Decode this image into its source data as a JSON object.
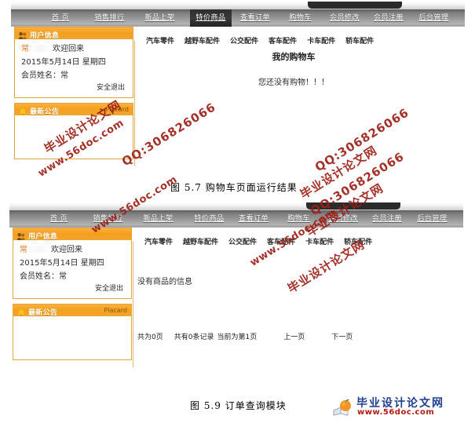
{
  "nav": {
    "items": [
      {
        "label": "首  页",
        "name": "nav-home",
        "active": false
      },
      {
        "label": "销售排行",
        "name": "nav-sales-rank",
        "active": false
      },
      {
        "label": "新品上架",
        "name": "nav-new-arrivals",
        "active": false
      },
      {
        "label": "特价商品",
        "name": "nav-special-offers",
        "active": true
      },
      {
        "label": "查看订单",
        "name": "nav-view-orders",
        "active": false
      },
      {
        "label": "购物车",
        "name": "nav-shopping-cart",
        "active": false
      },
      {
        "label": "会员修改",
        "name": "nav-member-edit",
        "active": false
      },
      {
        "label": "会员注册",
        "name": "nav-member-register",
        "active": false
      },
      {
        "label": "后台管理",
        "name": "nav-admin",
        "active": false
      }
    ],
    "items2": [
      {
        "label": "首  页",
        "name": "nav-home",
        "active": false
      },
      {
        "label": "销售排行",
        "name": "nav-sales-rank",
        "active": false
      },
      {
        "label": "新品上架",
        "name": "nav-new-arrivals",
        "active": false
      },
      {
        "label": "特价商品",
        "name": "nav-special-offers",
        "active": false
      },
      {
        "label": "查看订单",
        "name": "nav-view-orders",
        "active": false
      },
      {
        "label": "购物车",
        "name": "nav-shopping-cart",
        "active": false
      },
      {
        "label": "会员修改",
        "name": "nav-member-edit",
        "active": false
      },
      {
        "label": "会员注册",
        "name": "nav-member-register",
        "active": false
      },
      {
        "label": "后台管理",
        "name": "nav-admin",
        "active": false
      }
    ]
  },
  "subnav": {
    "items": [
      {
        "label": "汽车零件"
      },
      {
        "label": "越野车配件"
      },
      {
        "label": "公交配件"
      },
      {
        "label": "客车配件"
      },
      {
        "label": "卡车配件"
      },
      {
        "label": "轿车配件"
      }
    ]
  },
  "sidebar": {
    "user_panel": {
      "title": "用户信息",
      "icon": "user-icon",
      "welcome_prefix": "常",
      "welcome_suffix": "欢迎回来",
      "date": "2015年5月14日  星期四",
      "member_label": "会员姓名：常",
      "logout": "安全退出"
    },
    "placard_panel": {
      "title": "最新公告",
      "icon": "bell-icon",
      "right_label": "Placard"
    }
  },
  "shot1": {
    "main_title": "我的购物车",
    "empty_text": "您还没有购物！！！"
  },
  "shot2": {
    "no_goods_text": "没有商品的信息",
    "pager": {
      "total_pages": "共为0页",
      "total_records": "共有0条记录",
      "current_page": "当前为第1页",
      "prev": "上一页",
      "next": "下一页"
    }
  },
  "captions": {
    "fig57": "图 5.7 购物车页面运行结果",
    "fig59": "图 5.9 订单查询模块"
  },
  "watermark": {
    "cn": "毕业设计论文网",
    "url": "www.56doc.com",
    "qq": "QQ:306826066",
    "color": "#9c1f17"
  },
  "footer_logo": {
    "cn": "毕业设计论文网",
    "url": "www.56doc.com",
    "icon": "peach-book-logo"
  },
  "colors": {
    "nav_bg": "#9a9a9a",
    "nav_active": "#2e2e2e",
    "panel_accent": "#f5a01f",
    "panel_border": "#e2a63a",
    "logo_blue": "#1f3f8f",
    "logo_red": "#b31a13"
  }
}
